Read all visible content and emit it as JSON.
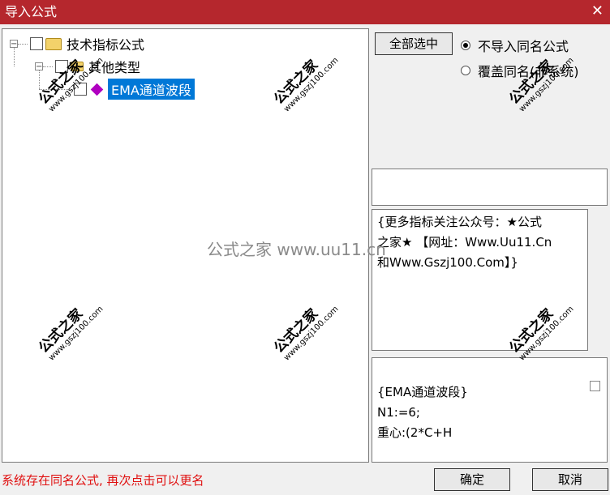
{
  "window": {
    "title": "导入公式",
    "close_glyph": "✕"
  },
  "tree": {
    "nodes": [
      {
        "label": "技术指标公式",
        "expander": "−"
      },
      {
        "label": "其他类型",
        "expander": "−"
      },
      {
        "label": "EMA通道波段"
      }
    ]
  },
  "options": {
    "select_all_label": "全部选中",
    "radio_skip_label": "不导入同名公式",
    "radio_overwrite_label": "覆盖同名(非系统)"
  },
  "description": {
    "line1": "{更多指标关注公众号：★公式",
    "line2": "之家★ 【网址：Www.Uu11.Cn",
    "line3": "和Www.Gszj100.Com】}"
  },
  "code_preview": {
    "line1": "{EMA通道波段}",
    "line2": "N1:=6;",
    "line3": "重心:(2*C+H"
  },
  "status_message": "系统存在同名公式, 再次点击可以更名",
  "buttons": {
    "ok_label": "确定",
    "cancel_label": "取消"
  },
  "watermark": {
    "brand": "公式之家",
    "site": "www.gszj100.com",
    "center_text": "公式之家 www.uu11.cn"
  },
  "colors": {
    "titlebar": "#b5272d",
    "selection": "#0078d7",
    "status": "#e01010"
  }
}
